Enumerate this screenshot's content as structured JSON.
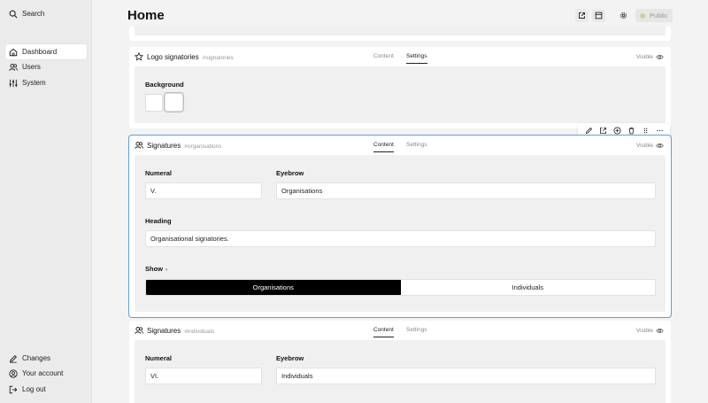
{
  "sidebar": {
    "search": "Search",
    "items": [
      {
        "label": "Dashboard",
        "icon": "home-icon"
      },
      {
        "label": "Users",
        "icon": "users-icon"
      },
      {
        "label": "System",
        "icon": "sliders-icon"
      }
    ],
    "bottom": [
      {
        "label": "Changes",
        "icon": "pencil-icon"
      },
      {
        "label": "Your account",
        "icon": "account-icon"
      },
      {
        "label": "Log out",
        "icon": "logout-icon"
      }
    ]
  },
  "header": {
    "title": "Home",
    "public_label": "Public"
  },
  "blocks": [
    {
      "title": "Logo signatories",
      "anchor": "#signatories",
      "tabs": [
        "Content",
        "Settings"
      ],
      "active_tab": "Settings",
      "visible_label": "Visible",
      "background_label": "Background"
    },
    {
      "title": "Signatures",
      "anchor": "#organisations",
      "tabs": [
        "Content",
        "Settings"
      ],
      "active_tab": "Content",
      "visible_label": "Visible",
      "numeral_label": "Numeral",
      "numeral_value": "V.",
      "eyebrow_label": "Eyebrow",
      "eyebrow_value": "Organisations",
      "heading_label": "Heading",
      "heading_value": "Organisational signatories.",
      "show_label": "Show",
      "show_options": [
        "Organisations",
        "Individuals"
      ],
      "show_selected": "Organisations"
    },
    {
      "title": "Signatures",
      "anchor": "#individuals",
      "tabs": [
        "Content",
        "Settings"
      ],
      "active_tab": "Content",
      "visible_label": "Visible",
      "numeral_label": "Numeral",
      "numeral_value": "VI.",
      "eyebrow_label": "Eyebrow",
      "eyebrow_value": "Individuals"
    }
  ],
  "toolbar": [
    "edit-icon",
    "open-icon",
    "add-icon",
    "delete-icon",
    "drag-icon",
    "more-icon"
  ]
}
